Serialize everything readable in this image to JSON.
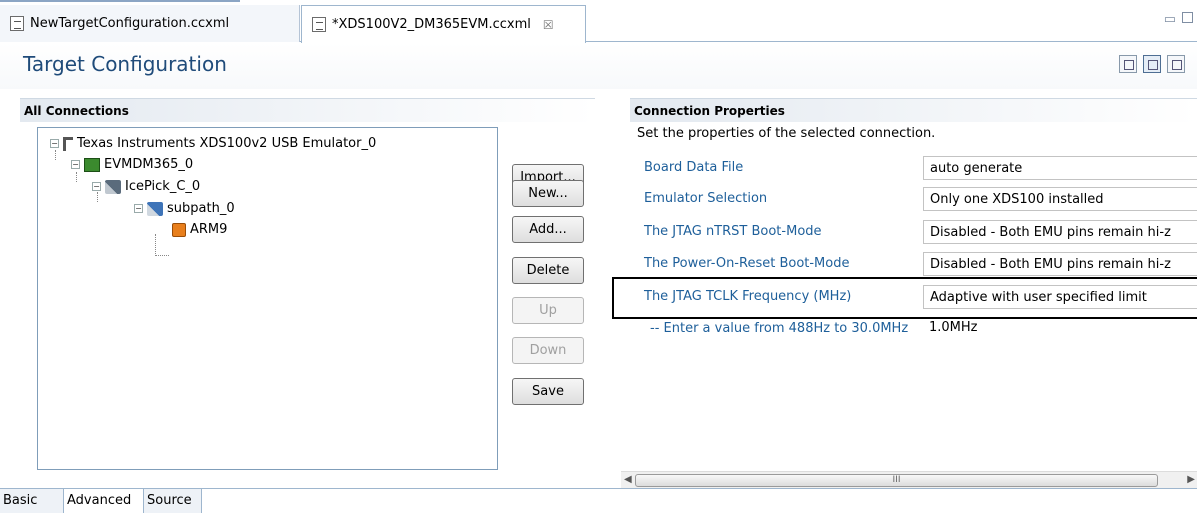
{
  "editor_tabs": [
    {
      "label": "NewTargetConfiguration.ccxml"
    },
    {
      "label": "*XDS100V2_DM365EVM.ccxml",
      "close": "☒"
    }
  ],
  "form": {
    "title": "Target Configuration"
  },
  "all_connections": {
    "title": "All Connections",
    "tree": [
      {
        "label": "Texas Instruments XDS100v2 USB Emulator_0",
        "icon": "emulator-icon"
      },
      {
        "label": "EVMDM365_0",
        "icon": "board-icon"
      },
      {
        "label": "IcePick_C_0",
        "icon": "icepick-icon"
      },
      {
        "label": "subpath_0",
        "icon": "subpath-icon"
      },
      {
        "label": "ARM9",
        "icon": "cpu-icon"
      }
    ],
    "buttons": {
      "import": "Import...",
      "new": "New...",
      "add": "Add...",
      "delete": "Delete",
      "up": "Up",
      "down": "Down",
      "save": "Save"
    }
  },
  "connection_properties": {
    "title": "Connection Properties",
    "description": "Set the properties of the selected connection.",
    "rows": [
      {
        "label": "Board Data File",
        "value": "auto generate"
      },
      {
        "label": "Emulator Selection",
        "value": "Only one XDS100 installed"
      },
      {
        "label": "The JTAG nTRST Boot-Mode",
        "value": "Disabled - Both EMU pins remain hi-z"
      },
      {
        "label": "The Power-On-Reset Boot-Mode",
        "value": "Disabled - Both EMU pins remain hi-z"
      },
      {
        "label": "The JTAG TCLK Frequency (MHz)",
        "value": "Adaptive with user specified limit"
      },
      {
        "label": "-- Enter a value from 488Hz to 30.0MHz",
        "value": "1.0MHz"
      }
    ]
  },
  "bottom_tabs": [
    "Basic",
    "Advanced",
    "Source"
  ]
}
